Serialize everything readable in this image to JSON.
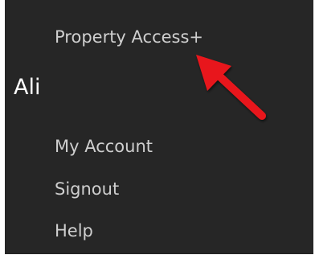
{
  "menu": {
    "items": [
      {
        "label": "Property Access+"
      },
      {
        "label": "My Account"
      },
      {
        "label": "Signout"
      },
      {
        "label": "Help"
      }
    ]
  },
  "user": {
    "name": "Ali"
  },
  "annotation": {
    "icon": "arrow-icon",
    "color": "#e8191b"
  },
  "colors": {
    "background": "#262626",
    "menu_text": "#cfcfcf",
    "user_text": "#ffffff"
  }
}
